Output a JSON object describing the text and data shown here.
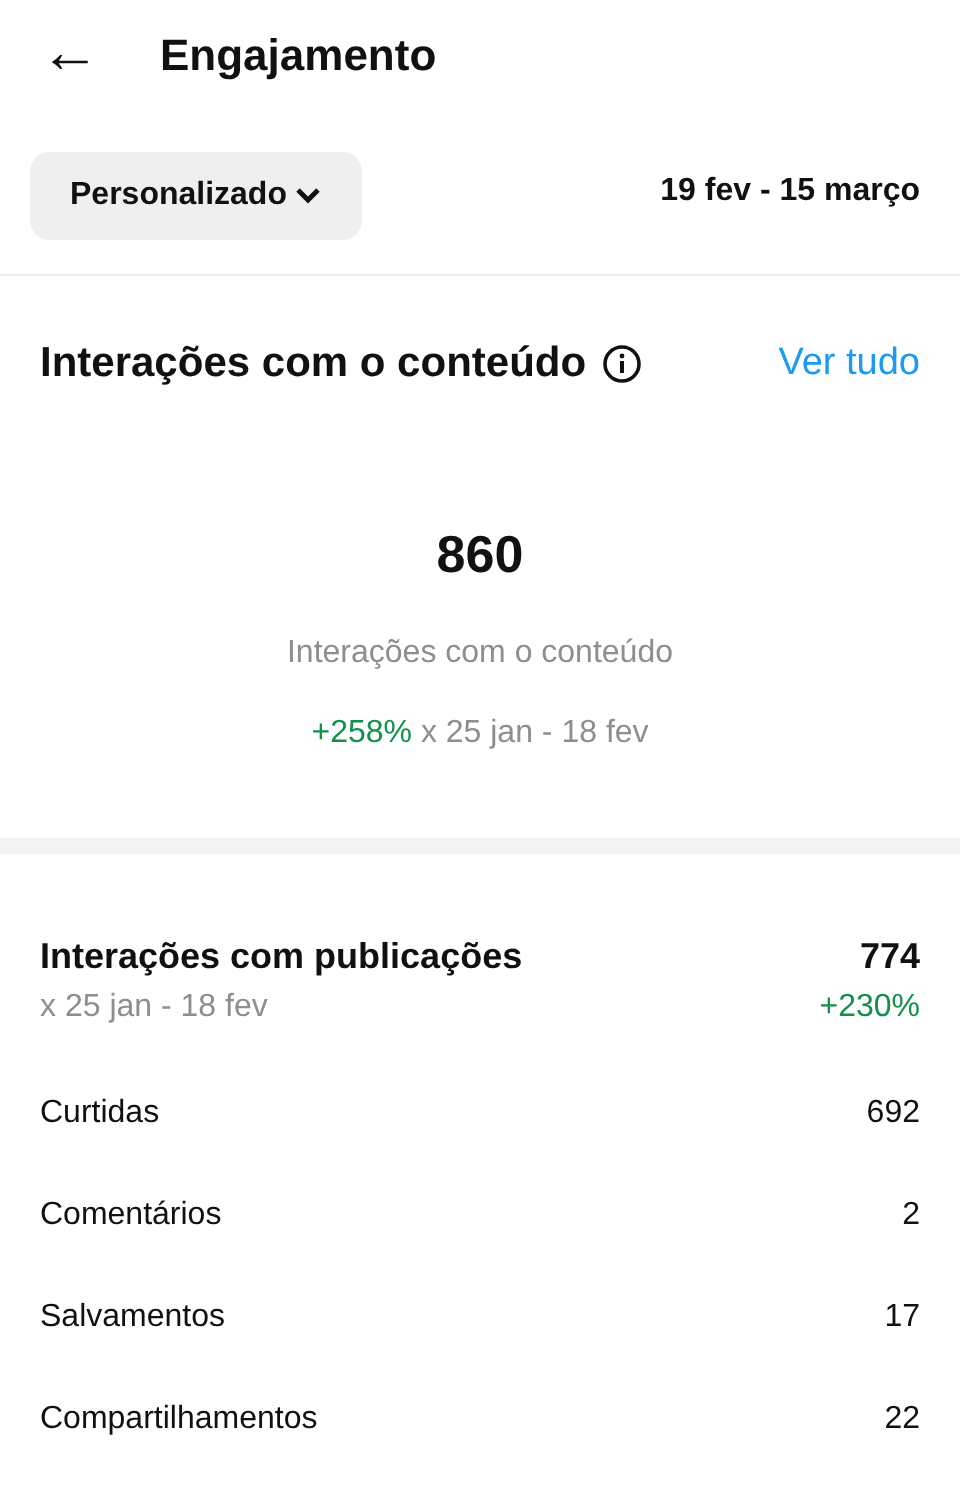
{
  "header": {
    "back_icon": "←",
    "title": "Engajamento"
  },
  "filter": {
    "dropdown": "Personalizado",
    "date_range": "19 fev - 15 março"
  },
  "summary": {
    "title": "Interações com o conteúdo",
    "link": "Ver tudo",
    "total": "860",
    "label": "Interações com o conteúdo",
    "change": "+258%",
    "comparison": "x 25 jan - 18 fev"
  },
  "posts": {
    "title": "Interações com publicações",
    "value": "774",
    "comparison": "x 25 jan - 18 fev",
    "change": "+230%",
    "rows": [
      {
        "label": "Curtidas",
        "value": "692"
      },
      {
        "label": "Comentários",
        "value": "2"
      },
      {
        "label": "Salvamentos",
        "value": "17"
      },
      {
        "label": "Compartilhamentos",
        "value": "22"
      }
    ]
  }
}
